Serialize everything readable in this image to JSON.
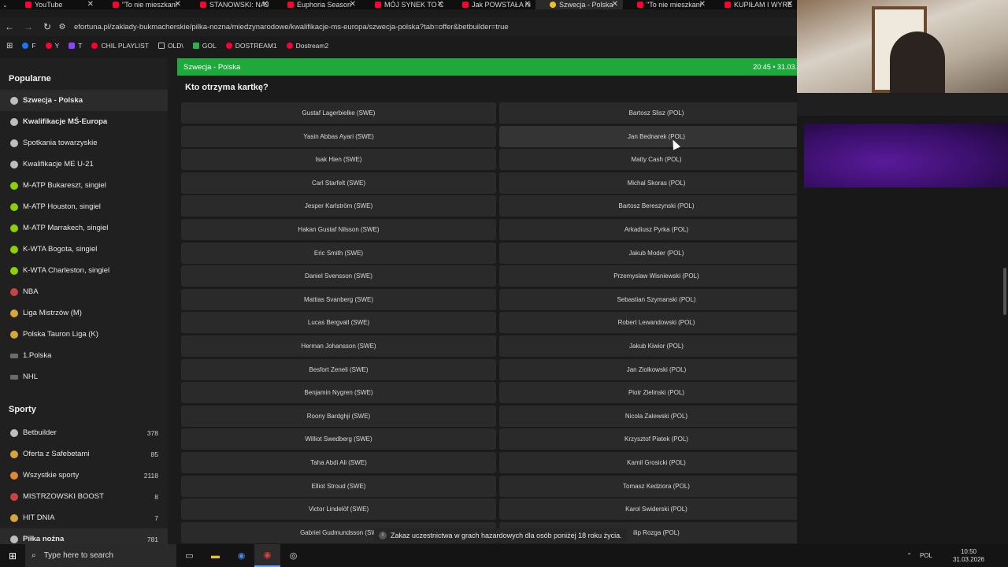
{
  "tabs": [
    {
      "label": "YouTube",
      "active": false
    },
    {
      "label": "\"To nie mieszkani",
      "active": false
    },
    {
      "label": "STANOWSKI: NAJ",
      "active": false
    },
    {
      "label": "Euphoria Season",
      "active": false
    },
    {
      "label": "MÓJ SYNEK TO C",
      "active": false
    },
    {
      "label": "Jak POWSTAŁA ni",
      "active": false
    },
    {
      "label": "Szwecja - Polska",
      "active": true
    },
    {
      "label": "\"To nie mieszkani",
      "active": false
    },
    {
      "label": "KUPIŁAM I WYRE",
      "active": false
    }
  ],
  "address": {
    "url": "efortuna.pl/zaklady-bukmacherskie/pilka-nozna/miedzynarodowe/kwalifikacje-ms-europa/szwecja-polska?tab=offer&betbuilder=true"
  },
  "bookmarks": [
    {
      "label": "F",
      "icon": "facebook-icon"
    },
    {
      "label": "Y",
      "icon": "youtube-icon"
    },
    {
      "label": "T",
      "icon": "x-icon"
    },
    {
      "label": "CHIL PLAYLIST",
      "icon": "youtube-icon"
    },
    {
      "label": "OLD\\",
      "icon": "folder-icon"
    },
    {
      "label": "GOL",
      "icon": "gol-icon"
    },
    {
      "label": "DOSTREAM1",
      "icon": "youtube-icon"
    },
    {
      "label": "Dostream2",
      "icon": "youtube-icon"
    }
  ],
  "sidebar": {
    "popular_title": "Popularne",
    "popular": [
      {
        "label": "Szwecja - Polska",
        "icon": "soccer-ball-icon",
        "active": true
      },
      {
        "label": "Kwalifikacje MŚ-Europa",
        "icon": "soccer-ball-icon",
        "bold": true
      },
      {
        "label": "Spotkania towarzyskie",
        "icon": "soccer-ball-icon"
      },
      {
        "label": "Kwalifikacje ME U-21",
        "icon": "soccer-ball-icon"
      },
      {
        "label": "M-ATP Bukareszt, singiel",
        "icon": "tennis-ball-icon"
      },
      {
        "label": "M-ATP Houston, singiel",
        "icon": "tennis-ball-icon"
      },
      {
        "label": "M-ATP Marrakech, singiel",
        "icon": "tennis-ball-icon"
      },
      {
        "label": "K-WTA Bogota, singiel",
        "icon": "tennis-ball-icon"
      },
      {
        "label": "K-WTA Charleston, singiel",
        "icon": "tennis-ball-icon"
      },
      {
        "label": "NBA",
        "icon": "basketball-icon"
      },
      {
        "label": "Liga Mistrzów (M)",
        "icon": "volleyball-icon"
      },
      {
        "label": "Polska Tauron Liga (K)",
        "icon": "volleyball-icon"
      },
      {
        "label": "1.Polska",
        "icon": "flag-icon"
      },
      {
        "label": "NHL",
        "icon": "flag-icon"
      }
    ],
    "sports_title": "Sporty",
    "sports": [
      {
        "label": "Betbuilder",
        "count": "378",
        "icon": "betbuilder-icon"
      },
      {
        "label": "Oferta z Safebetami",
        "count": "85",
        "icon": "safebet-icon"
      },
      {
        "label": "Wszystkie sporty",
        "count": "2118",
        "icon": "all-sports-icon"
      },
      {
        "label": "MISTRZOWSKI BOOST",
        "count": "8",
        "icon": "boost-icon"
      },
      {
        "label": "HIT DNIA",
        "count": "7",
        "icon": "hit-icon"
      },
      {
        "label": "Piłka nożna",
        "count": "781",
        "icon": "soccer-ball-icon"
      }
    ]
  },
  "match": {
    "title": "Szwecja  -  Polska",
    "time": "20:45  •  31.03."
  },
  "market": {
    "title": "Kto otrzyma kartkę?",
    "left": [
      "Gustaf Lagerbielke (SWE)",
      "Yasin Abbas Ayari (SWE)",
      "Isak Hien (SWE)",
      "Carl Starfelt (SWE)",
      "Jesper Karlström (SWE)",
      "Hakan Gustaf Nilsson (SWE)",
      "Eric Smith (SWE)",
      "Daniel Svensson (SWE)",
      "Mattias Svanberg (SWE)",
      "Lucas Bergvall (SWE)",
      "Herman Johansson (SWE)",
      "Besfort Zeneli (SWE)",
      "Benjamin Nygren (SWE)",
      "Roony Bardghji (SWE)",
      "Williot Swedberg (SWE)",
      "Taha Abdi Ali (SWE)",
      "Elliot Stroud (SWE)",
      "Victor Lindelöf (SWE)",
      "Gabriel Gudmundsson (SW"
    ],
    "right": [
      "Bartosz Slisz (POL)",
      "Jan Bednarek (POL)",
      "Matty Cash (POL)",
      "Michal Skoras (POL)",
      "Bartosz Bereszynski (POL)",
      "Arkadiusz Pyrka (POL)",
      "Jakub Moder (POL)",
      "Przemyslaw Wisniewski (POL)",
      "Sebastian Szymanski (POL)",
      "Robert Lewandowski (POL)",
      "Jakub Kiwior (POL)",
      "Jan Ziolkowski (POL)",
      "Piotr Zielinski (POL)",
      "Nicola Zalewski (POL)",
      "Krzysztof Piatek (POL)",
      "Kamil Grosicki (POL)",
      "Tomasz Kedziora (POL)",
      "Karol Swiderski (POL)",
      "ilip Rozga (POL)"
    ],
    "hovered_right_index": 1
  },
  "notice": "Zakaz uczestnictwa w grach hazardowych dla osób poniżej 18 roku życia.",
  "taskbar": {
    "search_placeholder": "Type here to search",
    "lang": "POL",
    "time": "10:50",
    "date": "31.03.2026"
  },
  "colors": {
    "accent_green": "#1fa83c",
    "youtube_red": "#ff0033"
  }
}
